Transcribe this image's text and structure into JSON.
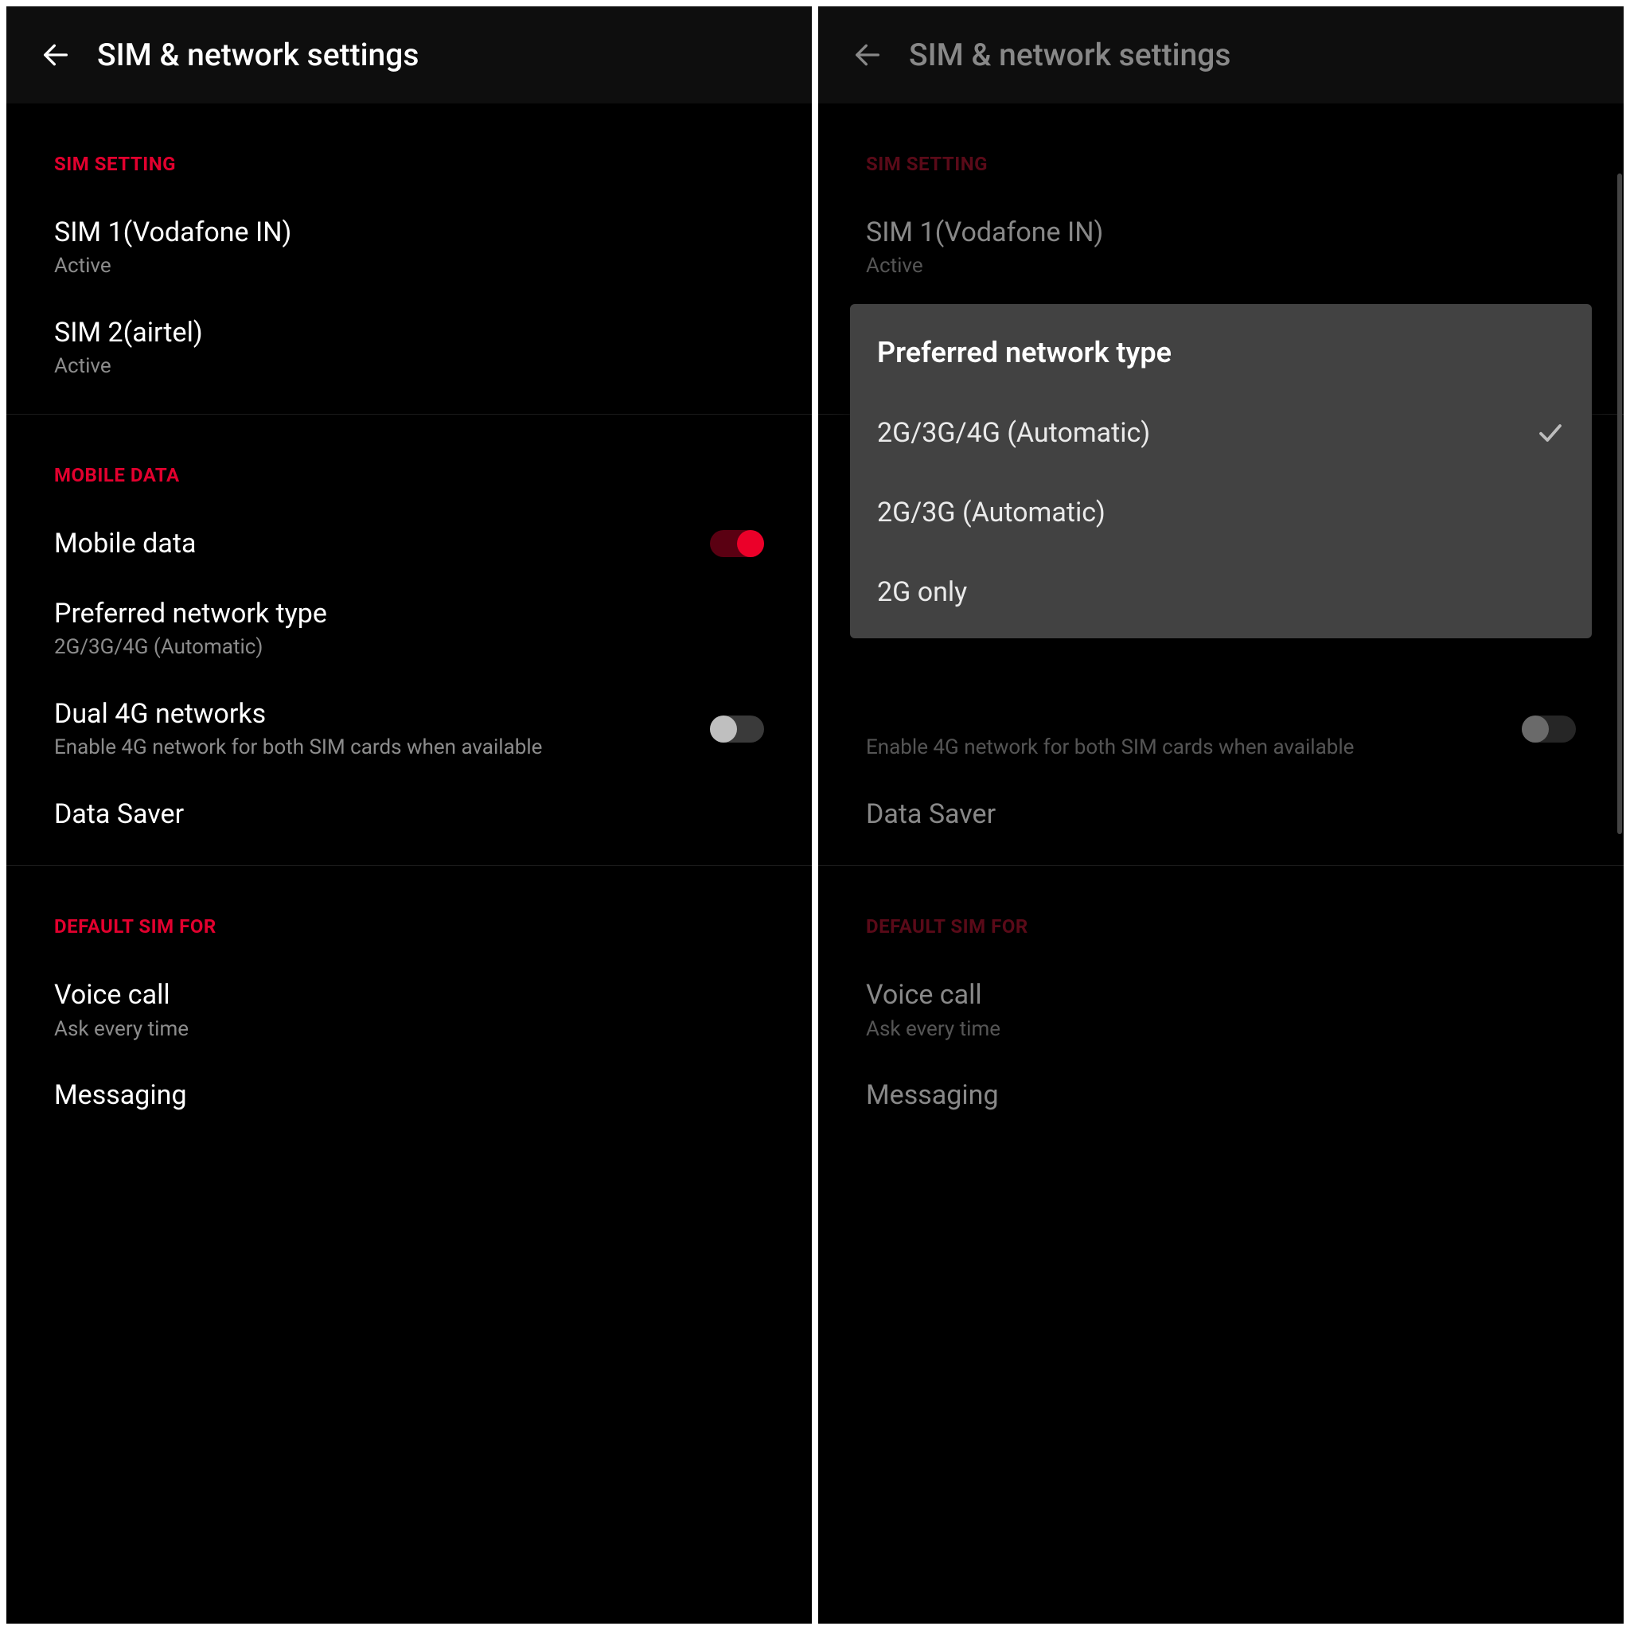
{
  "header": {
    "title": "SIM & network settings"
  },
  "sections": {
    "sim": {
      "header": "SIM SETTING",
      "sim1": {
        "title": "SIM 1(Vodafone IN)",
        "status": "Active"
      },
      "sim2": {
        "title": "SIM 2(airtel)",
        "status": "Active"
      }
    },
    "mobile_data": {
      "header": "MOBILE DATA",
      "mobile_data_label": "Mobile data",
      "preferred": {
        "title": "Preferred network type",
        "sub": "2G/3G/4G (Automatic)"
      },
      "dual4g": {
        "title": "Dual 4G networks",
        "sub": "Enable 4G network for both SIM cards when available"
      },
      "data_saver": "Data Saver"
    },
    "default_sim": {
      "header": "DEFAULT SIM FOR",
      "voice": {
        "title": "Voice call",
        "sub": "Ask every time"
      },
      "messaging": "Messaging"
    }
  },
  "dialog": {
    "title": "Preferred network type",
    "options": {
      "o1": "2G/3G/4G (Automatic)",
      "o2": "2G/3G (Automatic)",
      "o3": "2G only"
    }
  }
}
